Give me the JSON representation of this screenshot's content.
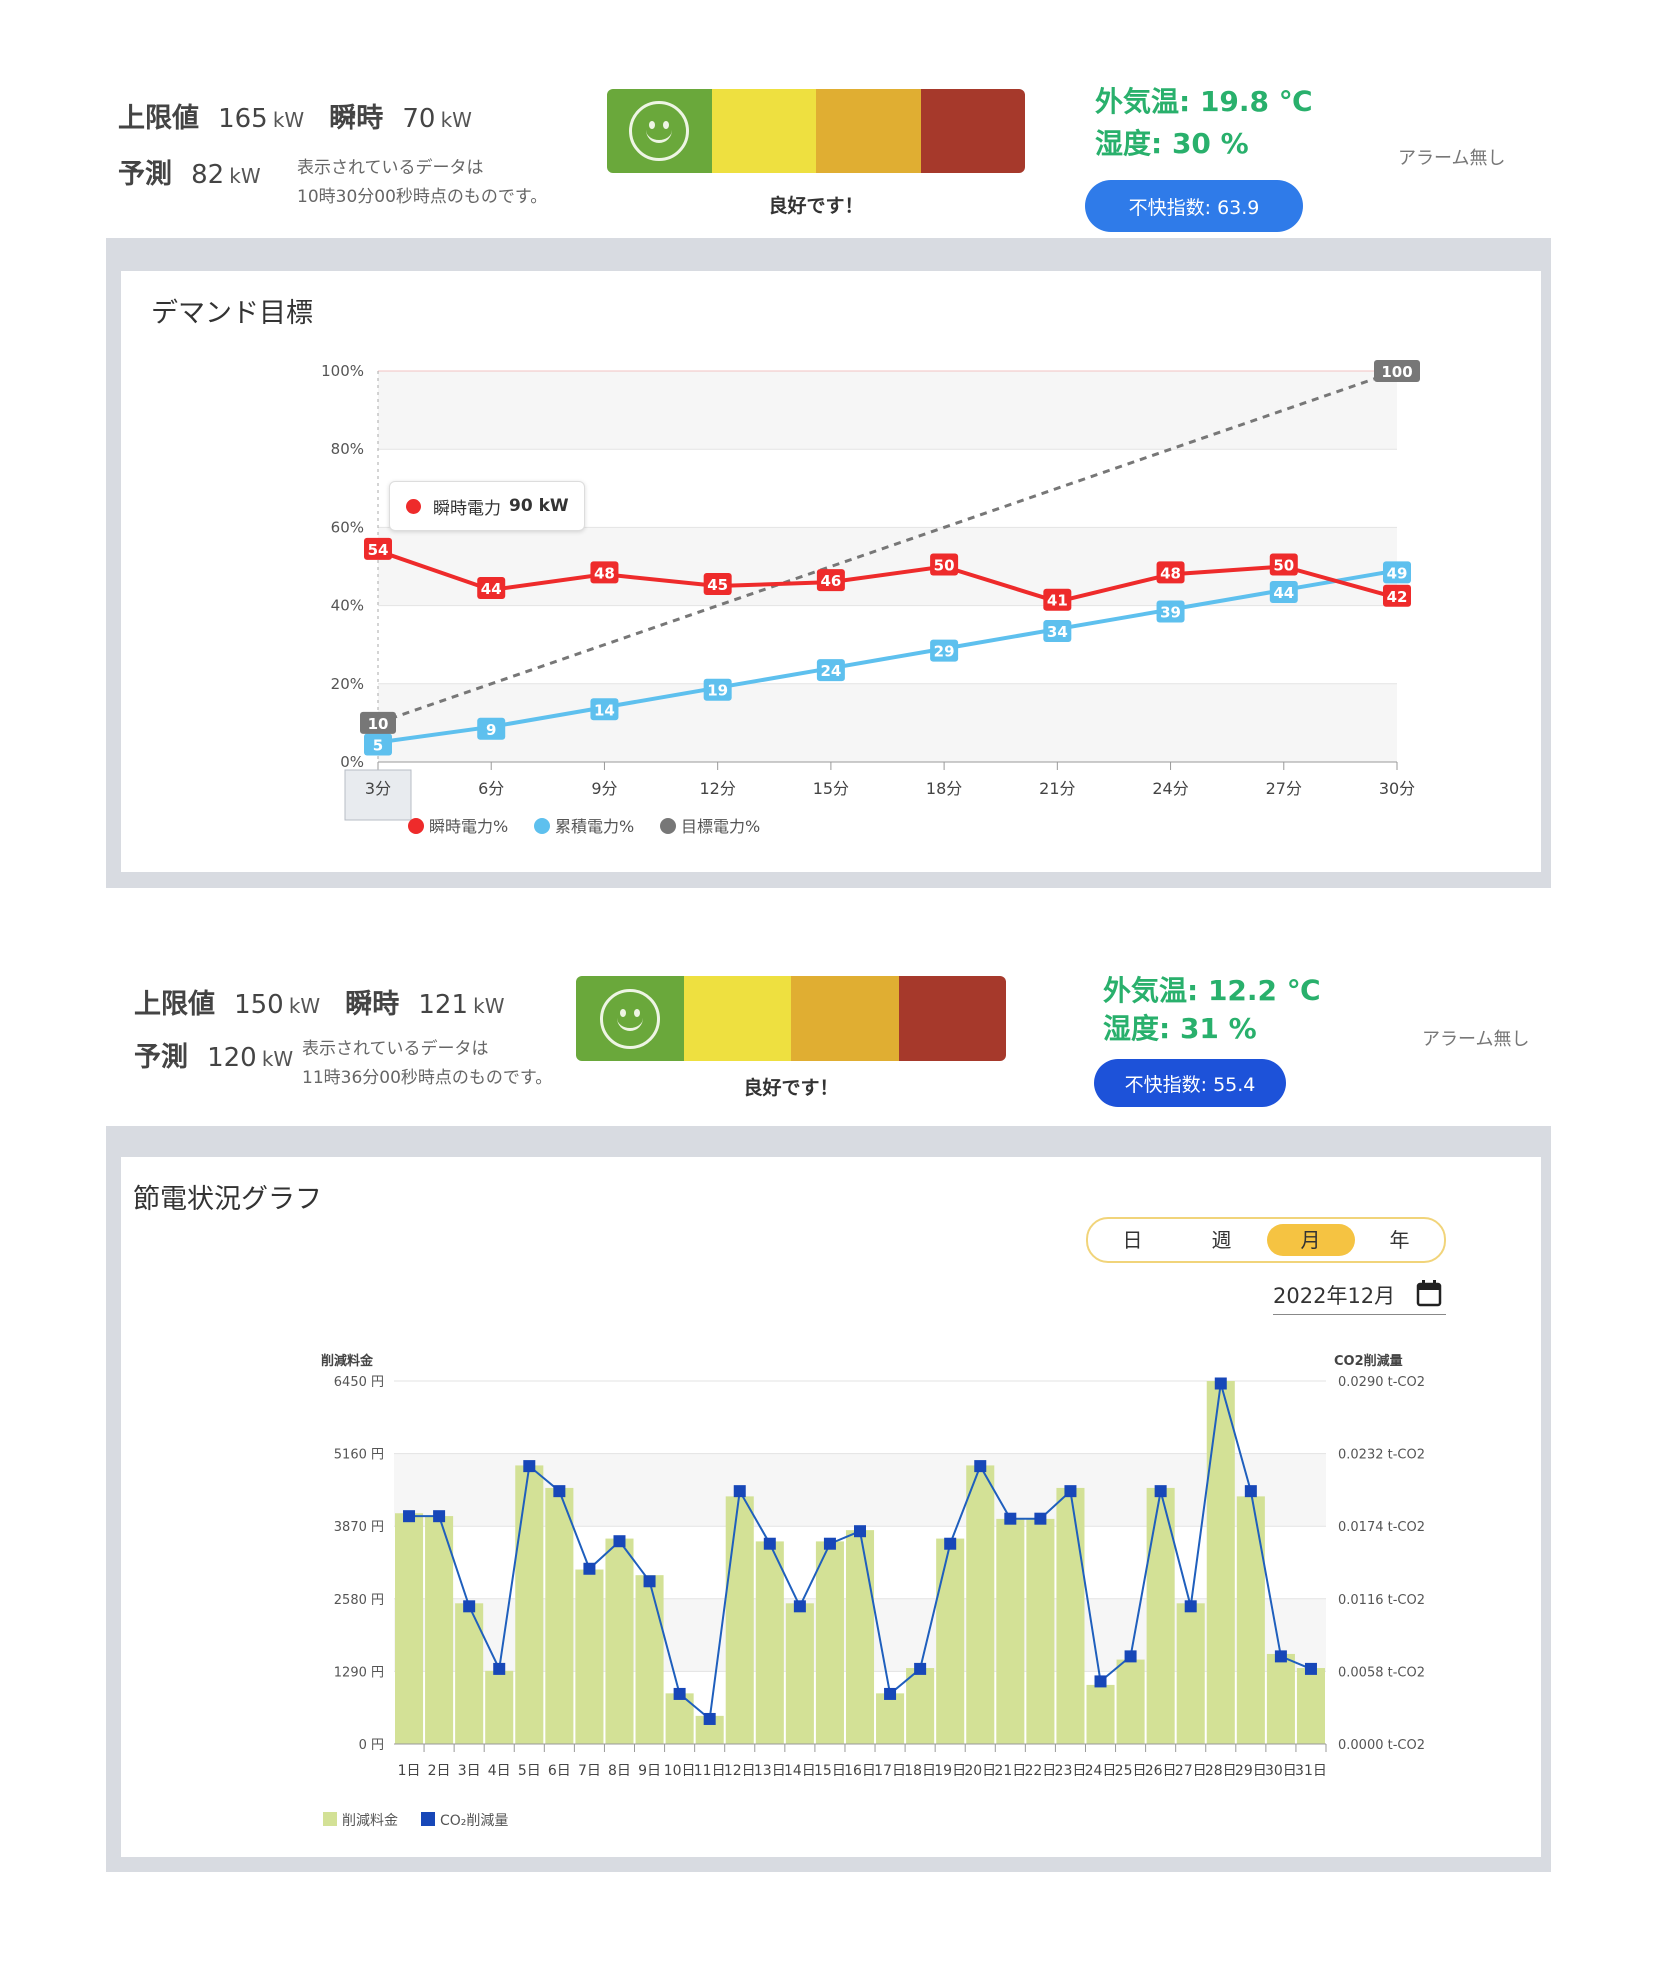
{
  "top_status": {
    "limit_label": "上限値",
    "limit_value": "165",
    "limit_unit": "kW",
    "instant_label": "瞬時",
    "instant_value": "70",
    "instant_unit": "kW",
    "forecast_label": "予測",
    "forecast_value": "82",
    "forecast_unit": "kW",
    "note_line1": "表示されているデータは",
    "note_line2": "10時30分00秒時点のものです。",
    "gauge_label": "良好です！",
    "temperature": "外気温: 19.8 ℃",
    "humidity": "湿度: 30 %",
    "discomfort": "不快指数: 63.9",
    "alarm": "アラーム無し"
  },
  "bottom_status": {
    "limit_label": "上限値",
    "limit_value": "150",
    "limit_unit": "kW",
    "instant_label": "瞬時",
    "instant_value": "121",
    "instant_unit": "kW",
    "forecast_label": "予測",
    "forecast_value": "120",
    "forecast_unit": "kW",
    "note_line1": "表示されているデータは",
    "note_line2": "11時36分00秒時点のものです。",
    "gauge_label": "良好です！",
    "temperature": "外気温: 12.2 ℃",
    "humidity": "湿度: 31 %",
    "discomfort": "不快指数: 55.4",
    "alarm": "アラーム無し"
  },
  "colors": {
    "gauge_green": "#6aa83b",
    "gauge_yellow": "#eee040",
    "gauge_orange": "#e0ae32",
    "gauge_red": "#a6392b",
    "red_series": "#ee2b2b",
    "blue_series": "#5ec0ee",
    "gray_series": "#777777",
    "bar": "#d3e196",
    "co2_line": "#1f5fbd",
    "pill_top": "#2f7be9",
    "pill_bottom": "#1d52d9"
  },
  "demand_panel": {
    "title": "デマンド目標",
    "tooltip_label": "瞬時電力",
    "tooltip_value": "90 kW",
    "chart_data": {
      "type": "line",
      "categories": [
        "3分",
        "6分",
        "9分",
        "12分",
        "15分",
        "18分",
        "21分",
        "24分",
        "27分",
        "30分"
      ],
      "y_ticks": [
        "0%",
        "20%",
        "40%",
        "60%",
        "80%",
        "100%"
      ],
      "ylim": [
        0,
        100
      ],
      "series": [
        {
          "name": "瞬時電力%",
          "color": "#ee2b2b",
          "values": [
            54,
            44,
            48,
            45,
            46,
            50,
            41,
            48,
            50,
            42
          ]
        },
        {
          "name": "累積電力%",
          "color": "#5ec0ee",
          "values": [
            5,
            9,
            14,
            19,
            24,
            29,
            34,
            39,
            44,
            49
          ]
        },
        {
          "name": "目標電力%",
          "color": "#777777",
          "line": "dashed",
          "points": [
            {
              "x": "3分",
              "y": 10
            },
            {
              "x": "30分",
              "y": 100
            }
          ]
        }
      ],
      "legend": "bottom-left"
    }
  },
  "savings_panel": {
    "title": "節電状況グラフ",
    "periods": [
      "日",
      "週",
      "月",
      "年"
    ],
    "active_period": "月",
    "date_value": "2022年12月",
    "chart_data": {
      "type": "bar",
      "categories": [
        "1日",
        "2日",
        "3日",
        "4日",
        "5日",
        "6日",
        "7日",
        "8日",
        "9日",
        "10日",
        "11日",
        "12日",
        "13日",
        "14日",
        "15日",
        "16日",
        "17日",
        "18日",
        "19日",
        "20日",
        "21日",
        "22日",
        "23日",
        "24日",
        "25日",
        "26日",
        "27日",
        "28日",
        "29日",
        "30日",
        "31日"
      ],
      "left_axis_title": "削減料金",
      "right_axis_title": "CO2削減量",
      "left_ticks": [
        "0 円",
        "1290 円",
        "2580 円",
        "3870 円",
        "5160 円",
        "6450 円"
      ],
      "right_ticks": [
        "0.0000 t-CO2",
        "0.0058 t-CO2",
        "0.0116 t-CO2",
        "0.0174 t-CO2",
        "0.0232 t-CO2",
        "0.0290 t-CO2"
      ],
      "ylim_left": [
        0,
        6450
      ],
      "ylim_right": [
        0,
        0.029
      ],
      "series": [
        {
          "name": "削減料金",
          "type": "bar",
          "color": "#d3e196",
          "values": [
            4100,
            4050,
            2500,
            1300,
            4950,
            4550,
            3100,
            3650,
            3000,
            900,
            500,
            4400,
            3600,
            2500,
            3600,
            3800,
            900,
            1350,
            3650,
            4950,
            4000,
            4000,
            4550,
            1050,
            1500,
            4550,
            2500,
            6450,
            4400,
            1600,
            1350
          ]
        },
        {
          "name": "CO₂削減量",
          "type": "line",
          "color": "#1f5fbd",
          "values": [
            0.0182,
            0.0182,
            0.011,
            0.006,
            0.0222,
            0.0202,
            0.014,
            0.0162,
            0.013,
            0.004,
            0.002,
            0.0202,
            0.016,
            0.011,
            0.016,
            0.017,
            0.004,
            0.006,
            0.016,
            0.0222,
            0.018,
            0.018,
            0.0202,
            0.005,
            0.007,
            0.0202,
            0.011,
            0.0288,
            0.0202,
            0.007,
            0.006
          ]
        }
      ],
      "legend": "bottom-left"
    }
  }
}
